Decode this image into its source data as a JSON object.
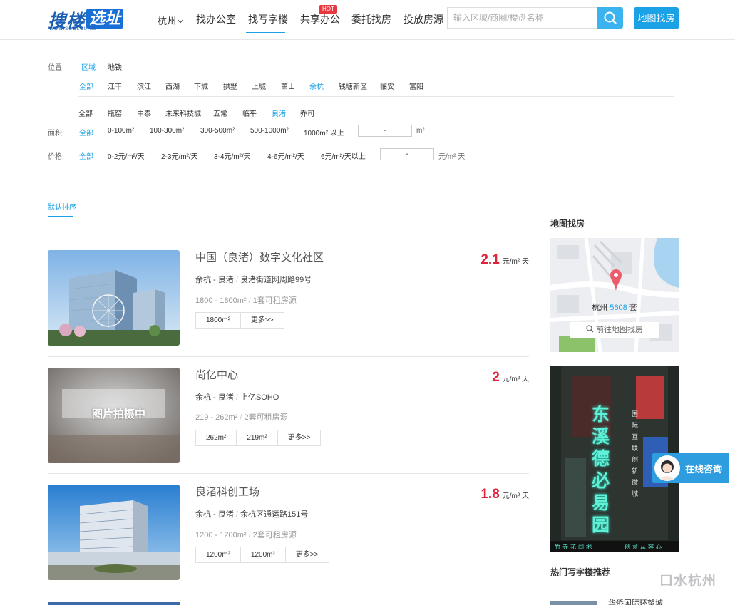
{
  "header": {
    "logo_text": "搜楼",
    "logo_badge": "选址",
    "logo_sub": "WWW.SOOLOU.NET",
    "city": "杭州",
    "nav": [
      "找办公室",
      "找写字楼",
      "共享办公",
      "委托找房",
      "投放房源"
    ],
    "hot_badge": "HOT",
    "search_placeholder": "输入区域/商圈/楼盘名称",
    "map_button": "地图找房"
  },
  "filters": {
    "position_label": "位置:",
    "position_tabs": [
      "区域",
      "地铁"
    ],
    "districts": [
      "全部",
      "江干",
      "滨江",
      "西湖",
      "下城",
      "拱墅",
      "上城",
      "萧山",
      "余杭",
      "钱塘新区",
      "临安",
      "富阳"
    ],
    "subareas": [
      "全部",
      "瓶窑",
      "中泰",
      "未来科技城",
      "五常",
      "临平",
      "良渚",
      "乔司"
    ],
    "area_label": "面积:",
    "area_options": [
      "全部",
      "0-100m²",
      "100-300m²",
      "300-500m²",
      "500-1000m²",
      "1000m² 以上"
    ],
    "area_input": "-",
    "area_unit": "m²",
    "price_label": "价格:",
    "price_options": [
      "全部",
      "0-2元/m²/天",
      "2-3元/m²/天",
      "3-4元/m²/天",
      "4-6元/m²/天",
      "6元/m²/天以上"
    ],
    "price_input": "-",
    "price_unit": "元/m² 天"
  },
  "sort": {
    "label": "默认排序"
  },
  "listings": [
    {
      "title": "中国（良渚）数字文化社区",
      "district": "余杭",
      "area": "良渚",
      "address": "良渚街道网周路99号",
      "size": "1800 - 1800m²",
      "count": "1套可租房源",
      "tags": [
        "1800m²",
        "更多>>"
      ],
      "price": "2.1",
      "unit": "元/m² 天"
    },
    {
      "title": "尚亿中心",
      "district": "余杭",
      "area": "良渚",
      "address": "上亿SOHO",
      "size": "219 - 262m²",
      "count": "2套可租房源",
      "tags": [
        "262m²",
        "219m²",
        "更多>>"
      ],
      "price": "2",
      "unit": "元/m² 天",
      "placeholder_text": "图片拍摄中"
    },
    {
      "title": "良渚科创工场",
      "district": "余杭",
      "area": "良渚",
      "address": "余杭区通运路151号",
      "size": "1200 - 1200m²",
      "count": "2套可租房源",
      "tags": [
        "1200m²",
        "1200m²",
        "更多>>"
      ],
      "price": "1.8",
      "unit": "元/m² 天"
    }
  ],
  "sidebar": {
    "map_title": "地图找房",
    "map_city": "杭州",
    "map_count": "5608",
    "map_count_unit": "套",
    "map_link": "前往地图找房",
    "ad_text": "东溪德必易园",
    "ad_vertical": "国际互联创新微城",
    "ad_bottom_left": "竹寺花间地",
    "ad_bottom_right": "创意从容心",
    "hot_title": "热门写字楼推荐",
    "hot_first": "华侨国际环望城"
  },
  "consult": {
    "label": "在线咨询"
  },
  "watermark": "口水杭州",
  "colors": {
    "accent": "#1aa1e6",
    "price": "#e0223c",
    "hot": "#e8373e"
  }
}
